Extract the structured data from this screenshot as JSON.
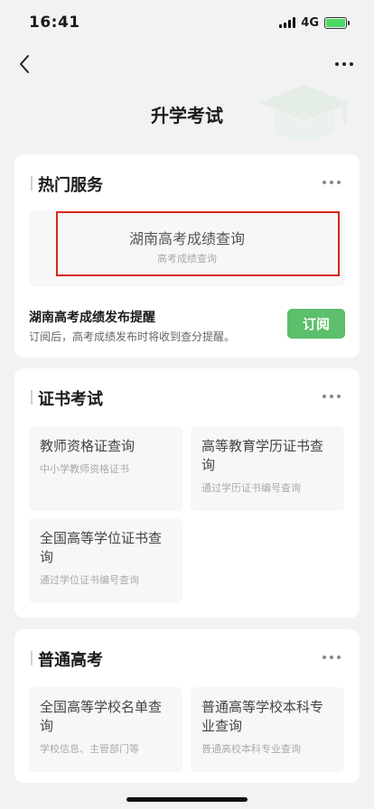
{
  "status_bar": {
    "time": "16:41",
    "network": "4G"
  },
  "header": {
    "title": "升学考试"
  },
  "hot_services": {
    "title": "热门服务",
    "item": {
      "title": "湖南高考成绩查询",
      "subtitle": "高考成绩查询"
    },
    "reminder": {
      "title": "湖南高考成绩发布提醒",
      "description": "订阅后，高考成绩发布时将收到查分提醒。",
      "button_label": "订阅"
    }
  },
  "certificate_exams": {
    "title": "证书考试",
    "items": [
      {
        "title": "教师资格证查询",
        "subtitle": "中小学教师资格证书"
      },
      {
        "title": "高等教育学历证书查询",
        "subtitle": "通过学历证书编号查询"
      },
      {
        "title": "全国高等学位证书查询",
        "subtitle": "通过学位证书编号查询"
      }
    ]
  },
  "college_entrance": {
    "title": "普通高考",
    "items": [
      {
        "title": "全国高等学校名单查询",
        "subtitle": "学校信息、主管部门等"
      },
      {
        "title": "普通高等学校本科专业查询",
        "subtitle": "普通高校本科专业查询"
      }
    ]
  },
  "colors": {
    "accent_green": "#5cbf6b",
    "highlight_red": "#d9261c",
    "background": "#f2f2f2"
  },
  "icons": [
    "back-arrow-icon",
    "more-dots-icon",
    "signal-icon",
    "battery-icon"
  ]
}
